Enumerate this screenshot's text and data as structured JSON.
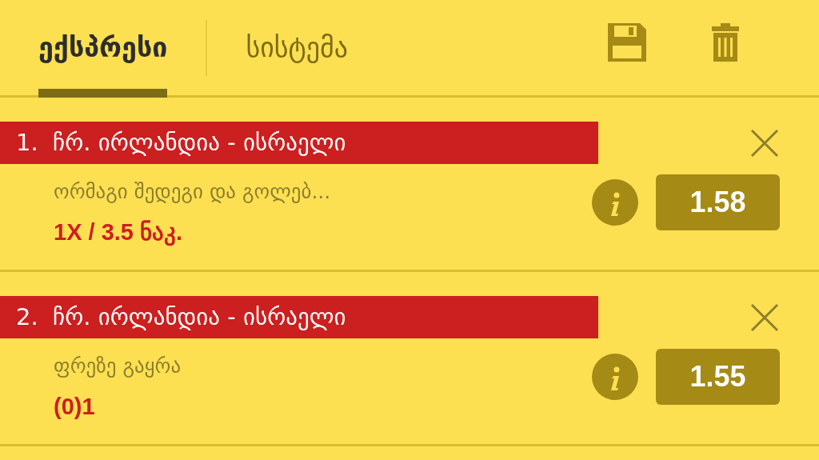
{
  "tabs": [
    {
      "label": "ექსპრესი",
      "selected": true
    },
    {
      "label": "სისტემა",
      "selected": false
    }
  ],
  "bets": [
    {
      "number": "1.",
      "match": "ჩრ. ირლანდია - ისრაელი",
      "market": "ორმაგი შედეგი და გოლებ...",
      "selection": "1X / 3.5 ნაკ.",
      "odds": "1.58"
    },
    {
      "number": "2.",
      "match": "ჩრ. ირლანდია - ისრაელი",
      "market": "ფრეზე გაყრა",
      "selection": "(0)1",
      "odds": "1.55"
    }
  ]
}
